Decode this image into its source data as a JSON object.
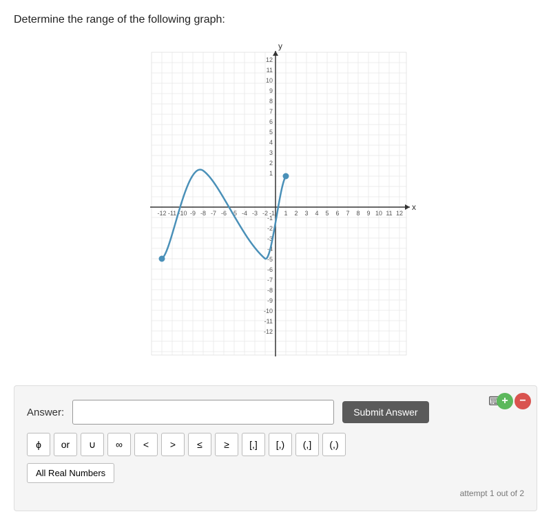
{
  "page": {
    "question": "Determine the range of the following graph:",
    "attempt_text": "attempt 1 out of 2"
  },
  "toolbar": {
    "plus_label": "+",
    "minus_label": "−"
  },
  "answer": {
    "label": "Answer:",
    "input_placeholder": "",
    "submit_label": "Submit Answer"
  },
  "symbols": [
    {
      "id": "phi",
      "label": "ϕ"
    },
    {
      "id": "or",
      "label": "or"
    },
    {
      "id": "union",
      "label": "∪"
    },
    {
      "id": "infinity",
      "label": "∞"
    },
    {
      "id": "lt",
      "label": "<"
    },
    {
      "id": "gt",
      "label": ">"
    },
    {
      "id": "lte",
      "label": "≤"
    },
    {
      "id": "gte",
      "label": "≥"
    },
    {
      "id": "bracket-left-close",
      "label": "[,]"
    },
    {
      "id": "paren-left-close",
      "label": "[,)"
    },
    {
      "id": "bracket-paren",
      "label": "(,]"
    },
    {
      "id": "paren-both",
      "label": "(,)"
    }
  ],
  "all_real_numbers": "All Real Numbers",
  "keyboard_icon": "⌨",
  "graph": {
    "x_min": -12,
    "x_max": 12,
    "y_min": -12,
    "y_max": 12,
    "x_label": "x",
    "y_label": "y"
  }
}
